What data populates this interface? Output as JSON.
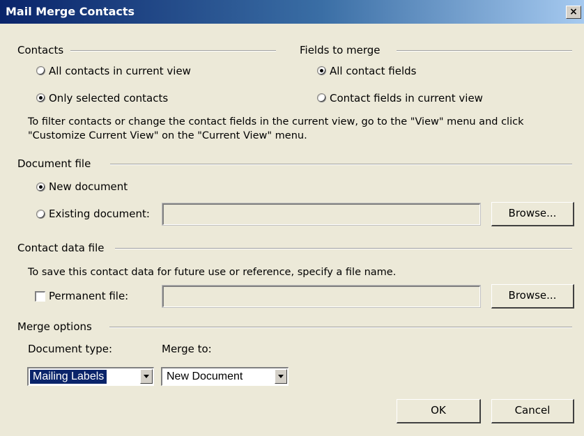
{
  "window": {
    "title": "Mail Merge Contacts",
    "close_label": "×"
  },
  "contacts": {
    "heading": "Contacts",
    "option_all": "All contacts in current view",
    "option_selected": "Only selected contacts",
    "selected": "Only selected contacts"
  },
  "fields": {
    "heading": "Fields to merge",
    "option_all": "All contact fields",
    "option_current": "Contact fields in current view",
    "selected": "All contact fields"
  },
  "hint": {
    "line1": "To filter contacts or change the contact fields in the current view, go to the \"View\" menu and click",
    "line2": "\"Customize Current View\" on the \"Current View\" menu."
  },
  "document_file": {
    "heading": "Document file",
    "option_new": "New document",
    "option_existing": "Existing document:",
    "existing_value": "",
    "browse_label": "Browse...",
    "selected": "New document"
  },
  "contact_data_file": {
    "heading": "Contact data file",
    "description": "To save this contact data for future use or reference, specify a file name.",
    "permanent_label": "Permanent file:",
    "permanent_checked": false,
    "file_value": "",
    "browse_label": "Browse..."
  },
  "merge_options": {
    "heading": "Merge options",
    "document_type_label": "Document type:",
    "document_type_value": "Mailing Labels",
    "merge_to_label": "Merge to:",
    "merge_to_value": "New Document"
  },
  "buttons": {
    "ok": "OK",
    "cancel": "Cancel"
  }
}
